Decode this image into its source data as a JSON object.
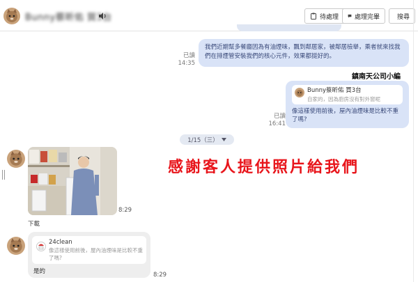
{
  "header": {
    "contact_name": "Bunny蔡昕佑 賀3台",
    "pending_label": "待處理",
    "done_label": "處理完畢",
    "search_label": "搜尋"
  },
  "messages": {
    "top_faded": "",
    "outgoing_1": {
      "text": "我們近期幫多餐廳因為有油煙味，飄到鄰居家，被鄰居檢舉，乘者就來找我們在排煙管安裝我們的核心元件，效果都挺好的。",
      "read": "已讀",
      "time": "14:35"
    },
    "sender_label": "鎮南天公司小編",
    "outgoing_2": {
      "quote_name": "Bunny蔡昕佑 買3台",
      "quote_text": "自家的，因為廚房沒有對外窗呢",
      "text": "像這樣使用前後，屋內油煙味是比較不重了嗎?",
      "read": "已讀",
      "time": "16:41"
    },
    "date_label": "1/15（三）",
    "photo_time": "8:29",
    "download_label": "下載",
    "caption": "感謝客人提供照片給我們",
    "incoming_reply": {
      "quote_name": "24clean",
      "quote_text": "像這樣使用前後，屋內油煙味是比較不重了嗎?",
      "text": "是的",
      "time": "8:29"
    }
  },
  "icons": {
    "sound": "speaker-icon",
    "pending": "clipboard-icon",
    "done": "chat-check-icon",
    "search": "search-icon",
    "date_chevron": "chevron-down-icon"
  },
  "colors": {
    "outgoing_bubble": "#d9e3f7",
    "incoming_bubble": "#eeeeee",
    "caption": "#e8151b"
  }
}
